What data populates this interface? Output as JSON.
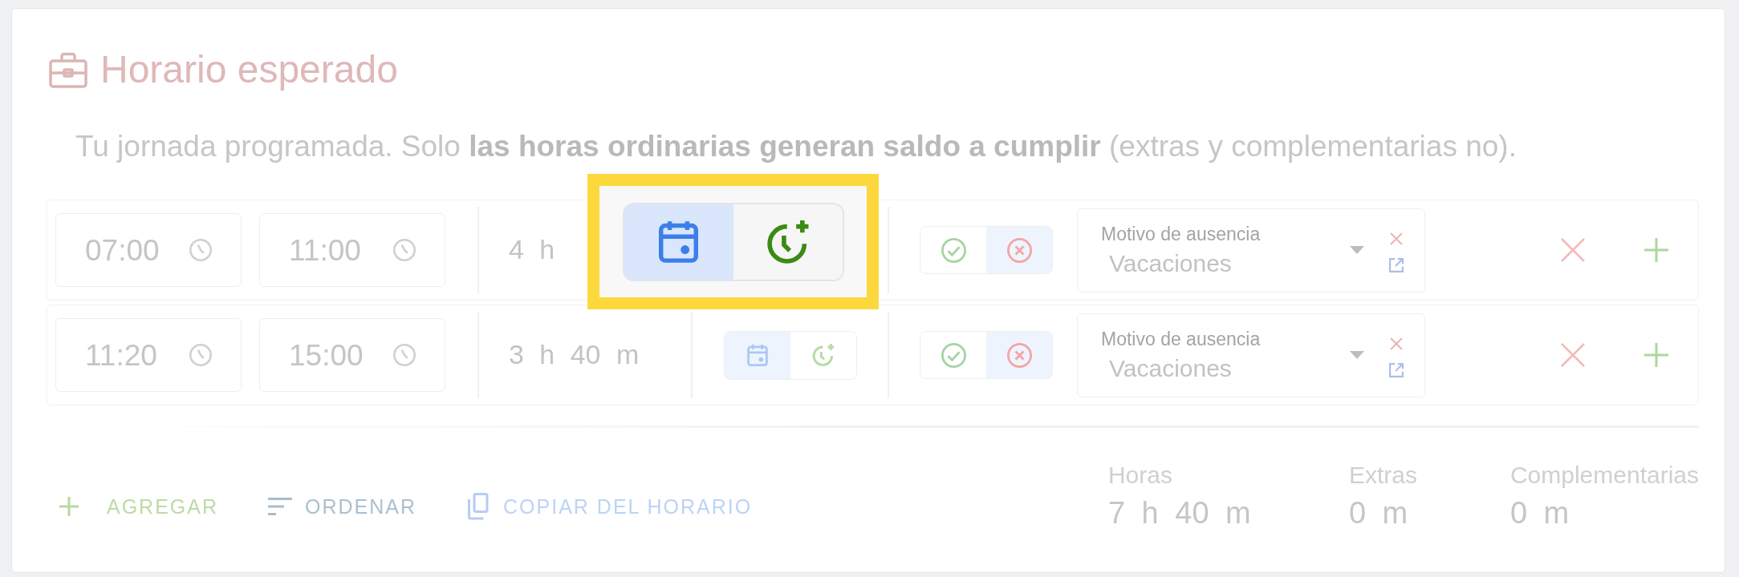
{
  "section": {
    "title": "Horario esperado",
    "description": "Tu jornada programada. Solo **las horas ordinarias generan saldo a cumplir** (extras y complementarias no)."
  },
  "rows": [
    {
      "start": "07:00",
      "end": "11:00",
      "duration": "4 h",
      "highlighted": true,
      "hour_types": [
        {
          "kind": "ordinary",
          "selected": true
        },
        {
          "kind": "extra",
          "selected": false
        }
      ],
      "attendance": [
        {
          "kind": "present",
          "selected": false
        },
        {
          "kind": "absent",
          "selected": true
        }
      ],
      "absence": {
        "label": "Motivo de ausencia",
        "value": "Vacaciones"
      }
    },
    {
      "start": "11:20",
      "end": "15:00",
      "duration": "3 h 40 m",
      "highlighted": false,
      "hour_types": [
        {
          "kind": "ordinary",
          "selected": true
        },
        {
          "kind": "extra",
          "selected": false
        }
      ],
      "attendance": [
        {
          "kind": "present",
          "selected": false
        },
        {
          "kind": "absent",
          "selected": true
        }
      ],
      "absence": {
        "label": "Motivo de ausencia",
        "value": "Vacaciones"
      }
    }
  ],
  "actions": [
    {
      "kind": "add",
      "label": "AGREGAR"
    },
    {
      "kind": "sort",
      "label": "ORDENAR"
    },
    {
      "kind": "copy",
      "label": "COPIAR DEL HORARIO"
    }
  ],
  "totals": [
    {
      "label": "Horas",
      "value": "7 h 40 m"
    },
    {
      "label": "Extras",
      "value": "0 m"
    },
    {
      "label": "Complementarias",
      "value": "0 m"
    }
  ]
}
